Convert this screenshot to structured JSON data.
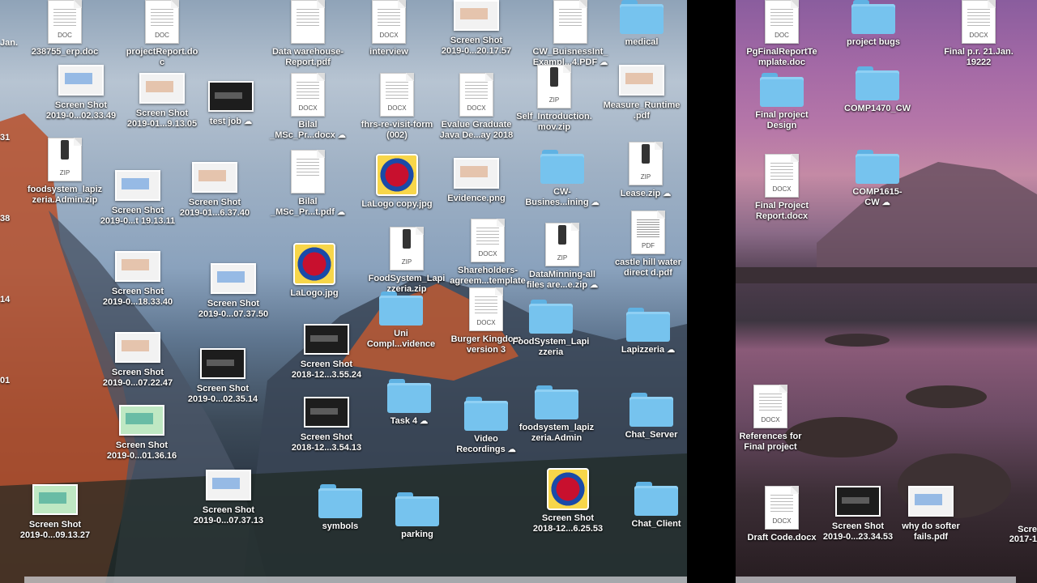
{
  "left_icons": [
    {
      "label": "238755_erp.doc",
      "kind": "doc",
      "ext": "DOC"
    },
    {
      "label": "projectReport.do\nc",
      "kind": "doc",
      "ext": "DOC"
    },
    {
      "label": "Data warehouse-\nReport.pdf",
      "kind": "doc",
      "ext": ""
    },
    {
      "label": "interview",
      "kind": "doc",
      "ext": "DOCX"
    },
    {
      "label": "Screen Shot\n2019-0...20.17.57",
      "kind": "shot"
    },
    {
      "label": "CW_BuisnessInt_\nExampl...4.PDF",
      "kind": "doc",
      "ext": "",
      "cloud": true
    },
    {
      "label": "medical",
      "kind": "folder"
    },
    {
      "label": "Screen Shot\n2019-0...02.33.49",
      "kind": "shot",
      "variant": "blue"
    },
    {
      "label": "Screen Shot\n2019-01...9.13.05",
      "kind": "shot"
    },
    {
      "label": "test job",
      "kind": "shot",
      "variant": "dark",
      "cloud": true
    },
    {
      "label": "Bilal\n_MSc_Pr...docx",
      "kind": "doc",
      "ext": "DOCX",
      "cloud": true
    },
    {
      "label": "fhrs-re-visit-form\n(002)",
      "kind": "doc",
      "ext": "DOCX"
    },
    {
      "label": "Evalue Graduate\nJava De...ay 2018",
      "kind": "doc",
      "ext": "DOCX"
    },
    {
      "label": "Self_Introduction.\nmov.zip",
      "kind": "zip",
      "ext": "ZIP"
    },
    {
      "label": "Measure_Runtime\n.pdf",
      "kind": "shot"
    },
    {
      "label": "foodsystem_lapiz\nzeria.Admin.zip",
      "kind": "zip",
      "ext": "ZIP"
    },
    {
      "label": "Screen Shot\n2019-0...t 19.13.11",
      "kind": "shot",
      "variant": "blue"
    },
    {
      "label": "Screen Shot\n2019-01...6.37.40",
      "kind": "shot"
    },
    {
      "label": "Bilal\n_MSc_Pr...t.pdf",
      "kind": "doc",
      "ext": "",
      "cloud": true
    },
    {
      "label": "LaLogo copy.jpg",
      "kind": "logo"
    },
    {
      "label": "Evidence.png",
      "kind": "shot"
    },
    {
      "label": "CW-\nBusines...ining",
      "kind": "folder",
      "cloud": true
    },
    {
      "label": "Lease.zip",
      "kind": "zip",
      "ext": "ZIP",
      "cloud": true
    },
    {
      "label": "Screen Shot\n2019-0...18.33.40",
      "kind": "shot"
    },
    {
      "label": "Screen Shot\n2019-0...07.37.50",
      "kind": "shot",
      "variant": "blue"
    },
    {
      "label": "LaLogo.jpg",
      "kind": "logo"
    },
    {
      "label": "FoodSystem_Lapi\nzzeria.zip",
      "kind": "zip",
      "ext": "ZIP"
    },
    {
      "label": "Shareholders-\nagreem...template",
      "kind": "doc",
      "ext": "DOCX"
    },
    {
      "label": "DataMinning-all\nfiles are...e.zip",
      "kind": "zip",
      "ext": "ZIP",
      "cloud": true
    },
    {
      "label": "castle hill water\ndirect d.pdf",
      "kind": "doc",
      "ext": "PDF"
    },
    {
      "label": "Screen Shot\n2019-0...07.22.47",
      "kind": "shot"
    },
    {
      "label": "Screen Shot\n2019-0...02.35.14",
      "kind": "shot",
      "variant": "dark"
    },
    {
      "label": "Screen Shot\n2018-12...3.55.24",
      "kind": "shot",
      "variant": "dark"
    },
    {
      "label": "Uni\nCompl...vidence",
      "kind": "folder"
    },
    {
      "label": "Burger Kingdom\nversion 3",
      "kind": "doc",
      "ext": "DOCX"
    },
    {
      "label": "FoodSystem_Lapi\nzzeria",
      "kind": "folder"
    },
    {
      "label": "Lapizzeria",
      "kind": "folder",
      "cloud": true
    },
    {
      "label": "Screen Shot\n2019-0...01.36.16",
      "kind": "shot",
      "variant": "green"
    },
    {
      "label": "Screen Shot\n2018-12...3.54.13",
      "kind": "shot",
      "variant": "dark"
    },
    {
      "label": "Task 4",
      "kind": "folder",
      "cloud": true
    },
    {
      "label": "Video\nRecordings",
      "kind": "folder",
      "cloud": true
    },
    {
      "label": "foodsystem_lapiz\nzeria.Admin",
      "kind": "folder"
    },
    {
      "label": "Chat_Server",
      "kind": "folder"
    },
    {
      "label": "Screen Shot\n2019-0...09.13.27",
      "kind": "shot",
      "variant": "green"
    },
    {
      "label": "Screen Shot\n2019-0...07.37.13",
      "kind": "shot",
      "variant": "blue"
    },
    {
      "label": "symbols",
      "kind": "folder"
    },
    {
      "label": "parking",
      "kind": "folder"
    },
    {
      "label": "Screen Shot\n2018-12...6.25.53",
      "kind": "logo"
    },
    {
      "label": "Chat_Client",
      "kind": "folder"
    }
  ],
  "right_icons": [
    {
      "label": "PgFinalReportTe\nmplate.doc",
      "kind": "doc",
      "ext": "DOC"
    },
    {
      "label": "project bugs",
      "kind": "folder"
    },
    {
      "label": "Final p.r. 21.Jan.\n19222",
      "kind": "doc",
      "ext": "DOCX"
    },
    {
      "label": "Final project\nDesign",
      "kind": "folder"
    },
    {
      "label": "COMP1470_CW",
      "kind": "folder"
    },
    {
      "label": "Final Project\nReport.docx",
      "kind": "doc",
      "ext": "DOCX"
    },
    {
      "label": "COMP1615-\nCW",
      "kind": "folder",
      "cloud": true
    },
    {
      "label": "References for\nFinal project",
      "kind": "doc",
      "ext": "DOCX"
    },
    {
      "label": "Draft Code.docx",
      "kind": "doc",
      "ext": "DOCX"
    },
    {
      "label": "Screen Shot\n2019-0...23.34.53",
      "kind": "shot",
      "variant": "dark"
    },
    {
      "label": "why do softer\nfails.pdf",
      "kind": "shot",
      "variant": "blue"
    }
  ],
  "edge_fragments": {
    "left_top": "Jan.",
    "left_numbers": [
      "31",
      "38",
      "14",
      "01"
    ],
    "right_bottom": "Scre\n2017-1"
  },
  "cloud_glyph": "☁"
}
